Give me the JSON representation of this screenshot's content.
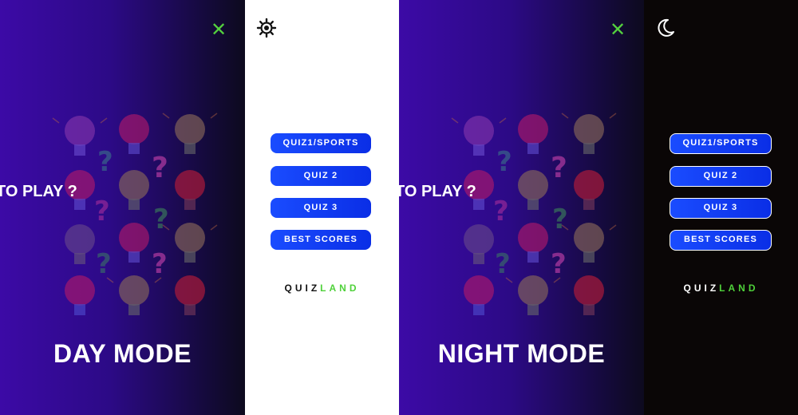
{
  "ready_text": "DY TO PLAY ?",
  "day": {
    "mode_title": "DAY MODE",
    "theme_icon": "sun-icon",
    "close_icon": "close-icon",
    "close_symbol": "✕"
  },
  "night": {
    "mode_title": "NIGHT MODE",
    "theme_icon": "moon-icon",
    "close_icon": "close-icon",
    "close_symbol": "✕"
  },
  "menu": {
    "buttons": [
      "QUIZ1/SPORTS",
      "QUIZ 2",
      "QUIZ 3",
      "BEST SCORES"
    ],
    "brand_part1": "QUIZ",
    "brand_part2": "LAND"
  },
  "colors": {
    "accent_green": "#4fd13a",
    "button_blue": "#1a4cff",
    "hero_purple": "#3c0aa6",
    "night_bg": "#0a0606",
    "day_bg": "#ffffff"
  }
}
